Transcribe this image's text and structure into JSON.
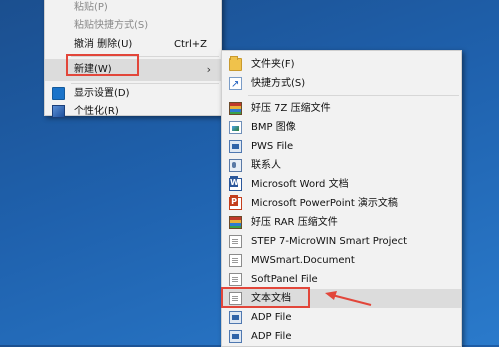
{
  "desktop_menu": {
    "paste": "粘贴(P)",
    "paste_shortcut": "粘贴快捷方式(S)",
    "undo_delete": "撤消 删除(U)",
    "undo_accel": "Ctrl+Z",
    "new": "新建(W)",
    "display_settings": "显示设置(D)",
    "personalize": "个性化(R)"
  },
  "new_submenu": {
    "items": [
      {
        "label": "文件夹(F)",
        "icon": "folder-icon"
      },
      {
        "label": "快捷方式(S)",
        "icon": "shortcut-icon"
      },
      {
        "label": "好压 7Z 压缩文件",
        "icon": "archive-icon"
      },
      {
        "label": "BMP 图像",
        "icon": "bmp-image-icon"
      },
      {
        "label": "PWS File",
        "icon": "pws-file-icon"
      },
      {
        "label": "联系人",
        "icon": "contact-icon"
      },
      {
        "label": "Microsoft Word 文档",
        "icon": "word-icon"
      },
      {
        "label": "Microsoft PowerPoint 演示文稿",
        "icon": "powerpoint-icon"
      },
      {
        "label": "好压 RAR 压缩文件",
        "icon": "archive-icon"
      },
      {
        "label": "STEP 7-MicroWIN Smart Project",
        "icon": "step7-project-icon"
      },
      {
        "label": "MWSmart.Document",
        "icon": "document-icon"
      },
      {
        "label": "SoftPanel File",
        "icon": "document-icon"
      },
      {
        "label": "文本文档",
        "icon": "text-document-icon"
      },
      {
        "label": "ADP File",
        "icon": "adp-file-icon"
      },
      {
        "label": "ADP File",
        "icon": "adp-file-icon"
      }
    ]
  },
  "colors": {
    "desktop_bg": "#1f61ad",
    "menu_bg": "#f2f2f2",
    "highlight": "#e2463a"
  }
}
